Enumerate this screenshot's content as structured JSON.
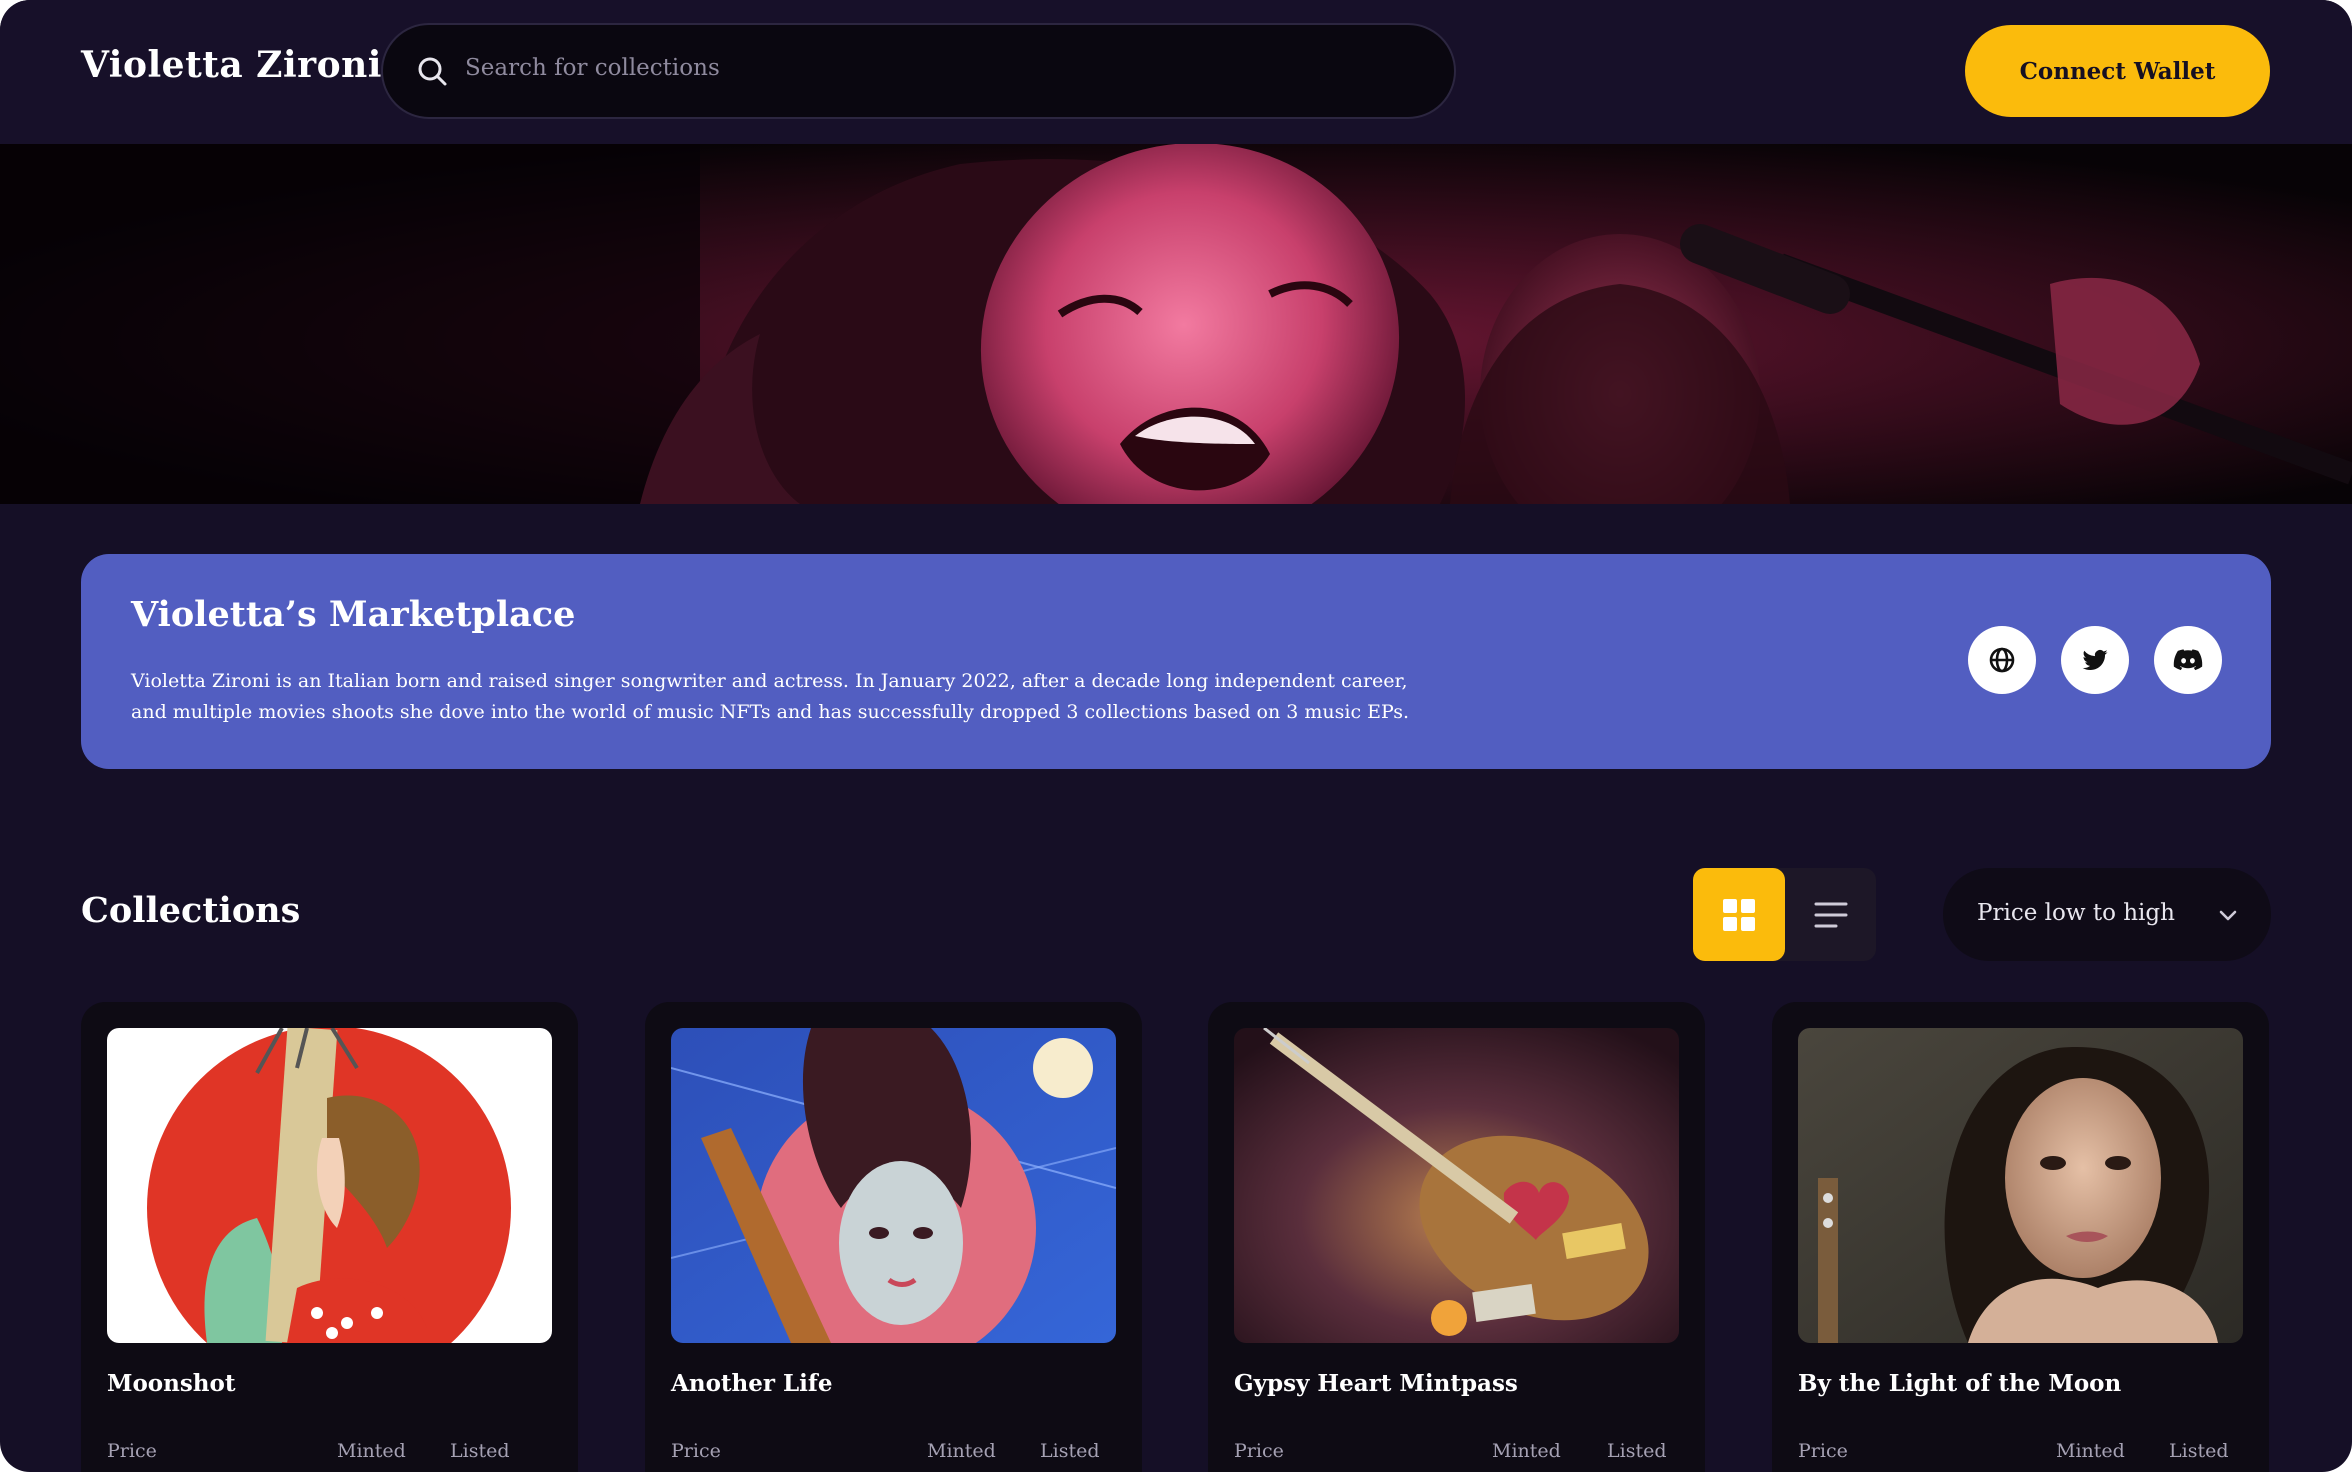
{
  "header": {
    "brand": "Violetta Zironi",
    "search_placeholder": "Search for collections",
    "connect_label": "Connect Wallet"
  },
  "marketplace": {
    "title": "Violetta’s Marketplace",
    "description": "Violetta Zironi is an Italian born and raised singer songwriter and actress. In January 2022, after a decade long independent career, and multiple movies shoots she dove into the world of music NFTs and has successfully dropped 3 collections based on 3 music EPs.",
    "socials": [
      "globe-icon",
      "twitter-icon",
      "discord-icon"
    ]
  },
  "collections": {
    "title": "Collections",
    "views": [
      "grid-view-icon",
      "list-view-icon"
    ],
    "active_view": "grid",
    "sort_selected": "Price low to high",
    "cards": [
      {
        "name": "Moonshot",
        "price_label": "Price",
        "minted_label": "Minted",
        "listed_label": "Listed"
      },
      {
        "name": "Another Life",
        "price_label": "Price",
        "minted_label": "Minted",
        "listed_label": "Listed"
      },
      {
        "name": "Gypsy Heart Mintpass",
        "price_label": "Price",
        "minted_label": "Minted",
        "listed_label": "Listed"
      },
      {
        "name": "By the Light of the Moon",
        "price_label": "Price",
        "minted_label": "Minted",
        "listed_label": "Listed"
      }
    ]
  },
  "colors": {
    "background": "#150f26",
    "accent": "#fbbb0c",
    "banner": "#525ec1"
  }
}
